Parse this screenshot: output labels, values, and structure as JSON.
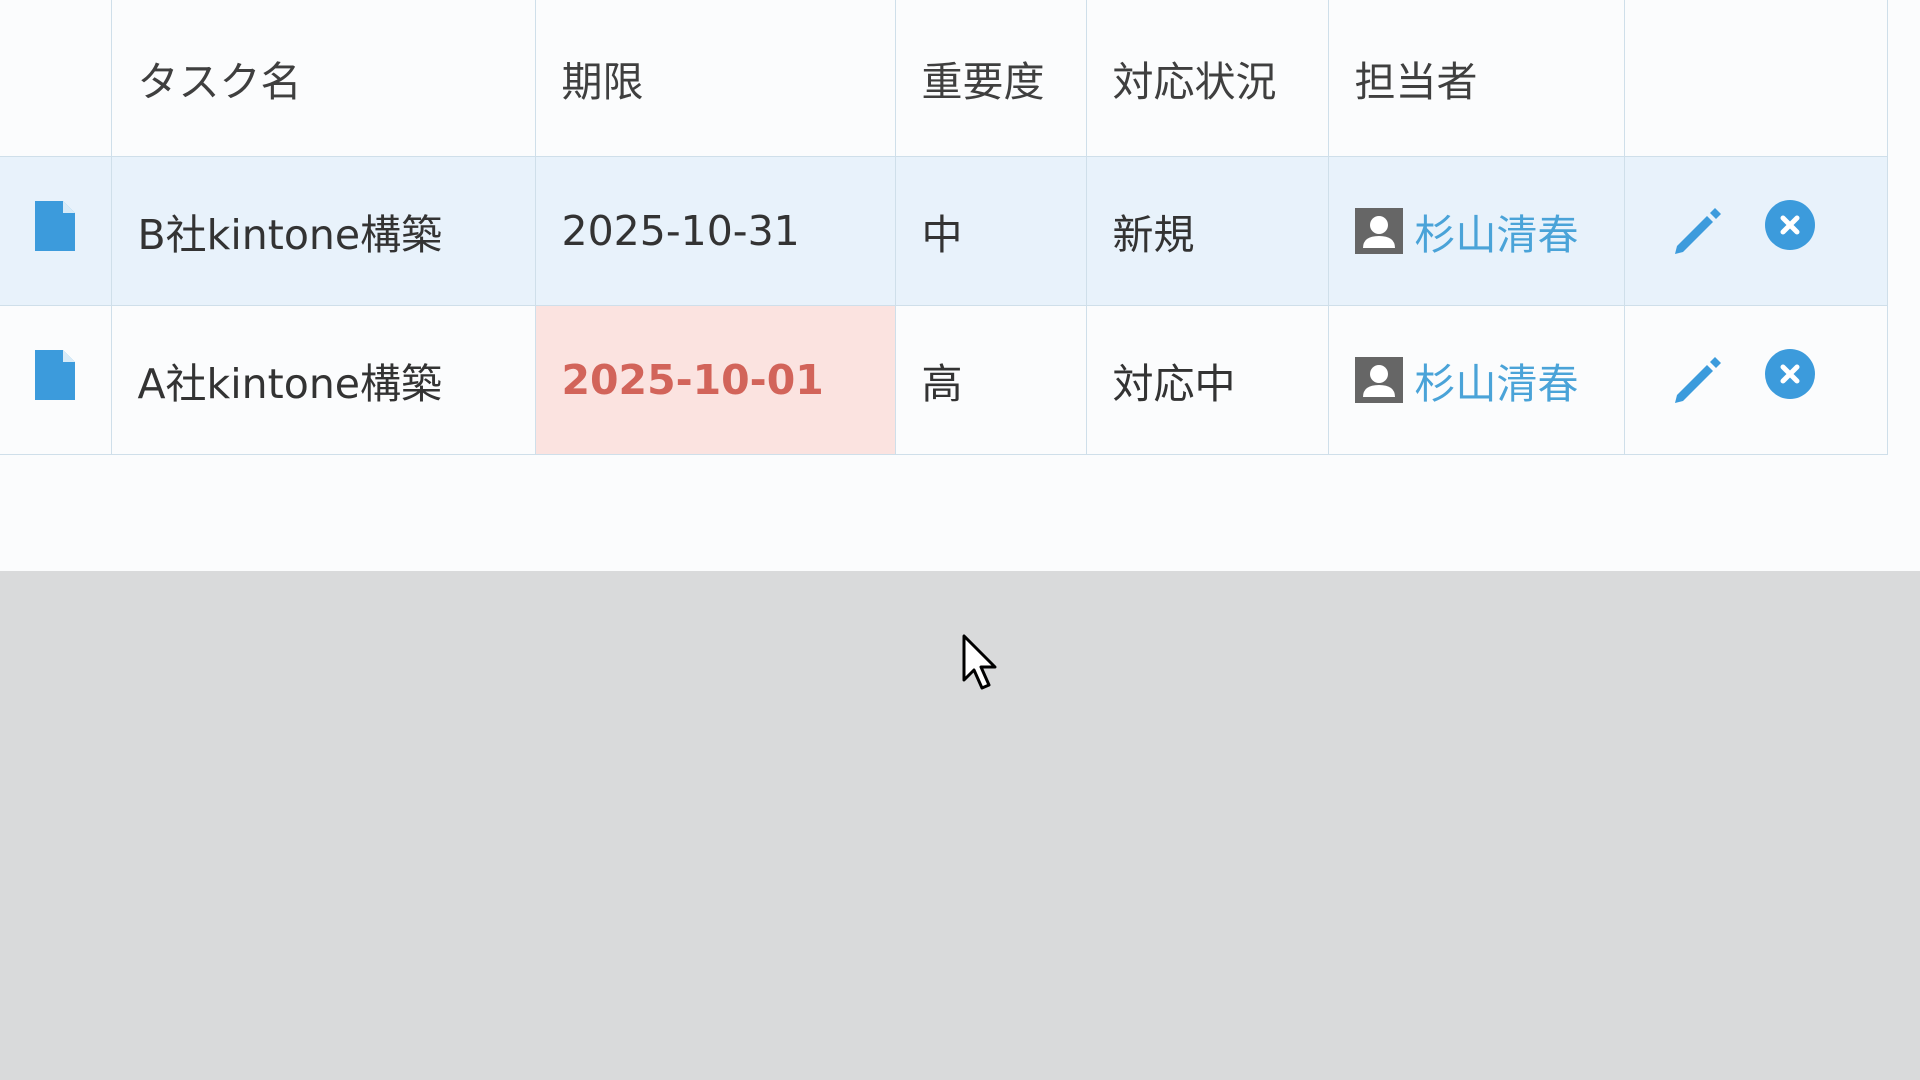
{
  "table": {
    "headers": {
      "task_name": "タスク名",
      "deadline": "期限",
      "importance": "重要度",
      "status": "対応状況",
      "assignee": "担当者"
    },
    "rows": [
      {
        "task_name": "B社kintone構築",
        "deadline": "2025-10-31",
        "importance": "中",
        "status": "新規",
        "assignee": "杉山清春",
        "selected": true,
        "overdue": false
      },
      {
        "task_name": "A社kintone構築",
        "deadline": "2025-10-01",
        "importance": "高",
        "status": "対応中",
        "assignee": "杉山清春",
        "selected": false,
        "overdue": true
      }
    ]
  },
  "icons": {
    "record": "document-icon",
    "assignee": "user-avatar-icon",
    "edit": "pencil-icon",
    "delete": "close-circle-icon"
  },
  "colors": {
    "accent": "#3c9bdc",
    "link": "#4aa3d8",
    "overdue_text": "#d2645a",
    "overdue_bg": "#fbe3e0",
    "selected_row_bg": "#e8f2fb"
  }
}
